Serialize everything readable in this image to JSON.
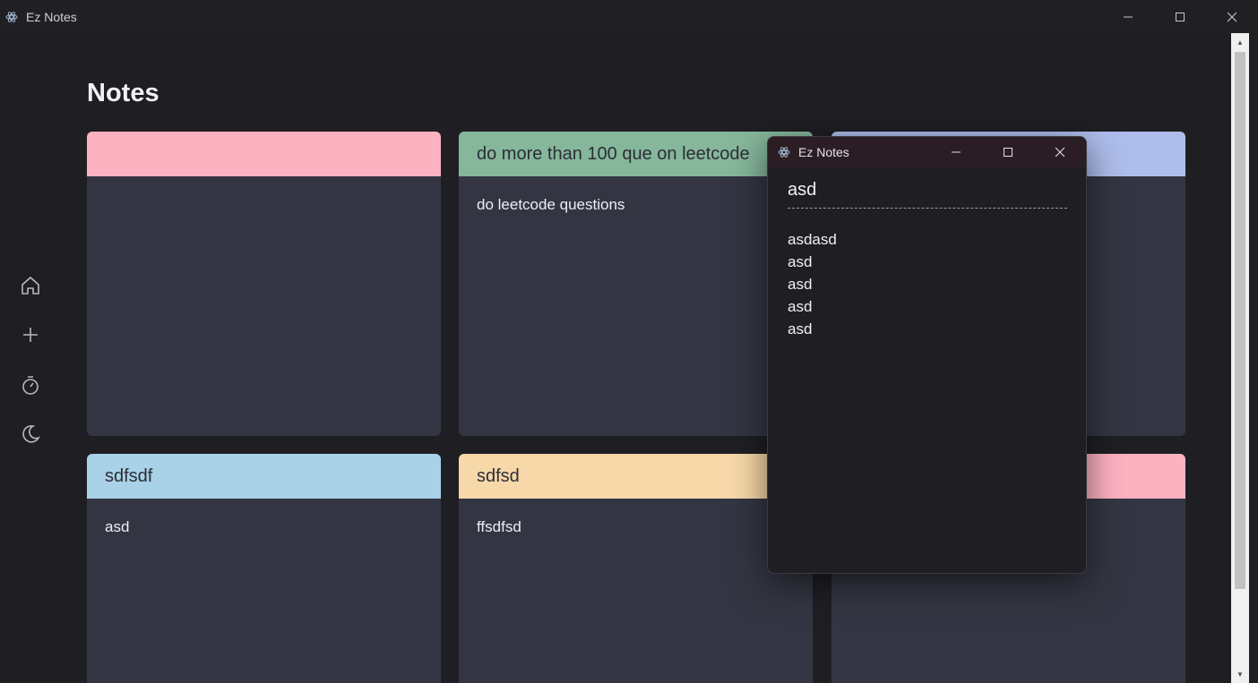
{
  "window": {
    "title": "Ez Notes"
  },
  "page": {
    "title": "Notes"
  },
  "sidebar": {
    "items": [
      {
        "name": "home-icon"
      },
      {
        "name": "plus-icon"
      },
      {
        "name": "timer-icon"
      },
      {
        "name": "moon-icon"
      }
    ]
  },
  "cards": [
    {
      "title": "",
      "body": "",
      "color": "#fdb2c2"
    },
    {
      "title": "do more than 100 que on leetcode",
      "body": "do leetcode questions",
      "color": "#86b79b"
    },
    {
      "title": "",
      "body": "",
      "color": "#aebdeb"
    },
    {
      "title": "sdfsdf",
      "body": "asd",
      "color": "#a9d1e7"
    },
    {
      "title": "sdfsd",
      "body": "ffsdfsd",
      "color": "#f6d8a9"
    },
    {
      "title": "",
      "body": "",
      "color": "#fdb2c2"
    }
  ],
  "popup": {
    "title": "Ez Notes",
    "note_title": "asd",
    "lines": [
      "asdasd",
      "asd",
      "asd",
      "asd",
      "asd"
    ]
  }
}
